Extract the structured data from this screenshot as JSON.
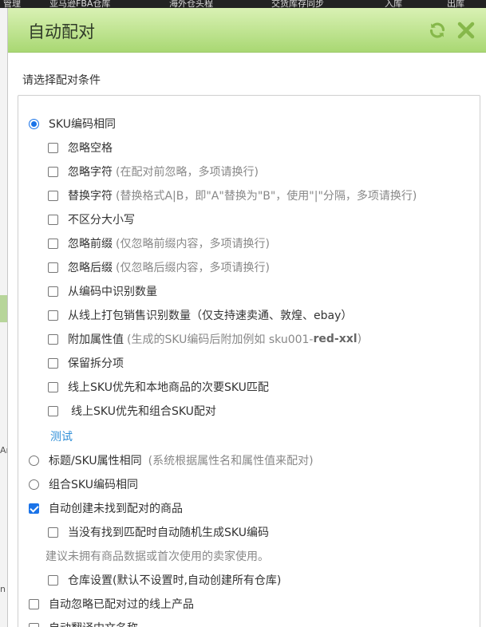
{
  "background": {
    "top_tabs": [
      "管理",
      "亚马逊FBA仓库",
      "海外仓头程",
      "交货库存同步",
      "入库",
      "出库"
    ],
    "left_fragments": [
      "Ar",
      "n"
    ]
  },
  "dialog": {
    "title": "自动配对",
    "refresh_icon": "refresh-icon",
    "close_icon": "close-icon",
    "subtitle": "请选择配对条件",
    "accent_color": "#1a73e8",
    "header_color": "#b9e08a"
  },
  "options": {
    "sku_same": {
      "label": "SKU编码相同",
      "selected": true
    },
    "ignore_space": {
      "label": "忽略空格",
      "checked": false
    },
    "ignore_chars": {
      "label": "忽略字符",
      "hint": "(在配对前忽略，多项请换行)",
      "checked": false
    },
    "replace_chars": {
      "label": "替换字符",
      "hint": "(替换格式A|B，即\"A\"替换为\"B\"，使用\"|\"分隔，多项请换行)",
      "checked": false
    },
    "case_insensitive": {
      "label": "不区分大小写",
      "checked": false
    },
    "ignore_prefix": {
      "label": "忽略前缀",
      "hint": "(仅忽略前缀内容，多项请换行)",
      "checked": false
    },
    "ignore_suffix": {
      "label": "忽略后缀",
      "hint": "(仅忽略后缀内容，多项请换行)",
      "checked": false
    },
    "qty_from_code": {
      "label": "从编码中识别数量",
      "checked": false
    },
    "qty_from_online": {
      "label": "从线上打包销售识别数量（仅支持速卖通、敦煌、ebay）",
      "checked": false
    },
    "append_attr": {
      "label": "附加属性值",
      "hint_prefix": "(生成的SKU编码后附加例如 sku001-",
      "hint_bold": "red-xxl",
      "hint_suffix": ")",
      "checked": false
    },
    "keep_split": {
      "label": "保留拆分项",
      "checked": false
    },
    "online_priority_local": {
      "label": "线上SKU优先和本地商品的次要SKU匹配",
      "checked": false
    },
    "online_priority_combo": {
      "label": "线上SKU优先和组合SKU配对",
      "checked": false
    },
    "test_link": "测试",
    "title_attr_same": {
      "label": "标题/SKU属性相同",
      "hint": "(系统根据属性名和属性值来配对)",
      "selected": false
    },
    "combo_sku_same": {
      "label": "组合SKU编码相同",
      "selected": false
    },
    "auto_create": {
      "label": "自动创建未找到配对的商品",
      "checked": true
    },
    "auto_random_sku": {
      "label": "当没有找到匹配时自动随机生成SKU编码",
      "checked": false
    },
    "auto_create_note": "建议未拥有商品数据或首次使用的卖家使用。",
    "warehouse_setting": {
      "label": "仓库设置(默认不设置时,自动创建所有仓库)",
      "checked": false
    },
    "auto_ignore_paired": {
      "label": "自动忽略已配对过的线上产品",
      "checked": false
    },
    "auto_translate": {
      "label": "自动翻译中文名称",
      "checked": false
    }
  }
}
